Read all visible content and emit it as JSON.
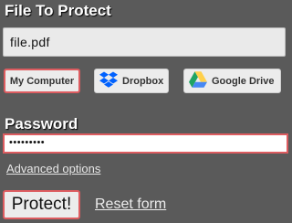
{
  "file_section": {
    "title": "File To Protect",
    "filename": "file.pdf"
  },
  "sources": {
    "computer_label": "My Computer",
    "dropbox_label": "Dropbox",
    "gdrive_label": "Google Drive",
    "selected": "My Computer"
  },
  "password_section": {
    "title": "Password",
    "masked_value": "•••••••••"
  },
  "links": {
    "advanced_options": "Advanced options",
    "reset_form": "Reset form"
  },
  "actions": {
    "protect_label": "Protect!"
  },
  "colors": {
    "background": "#5a5a5a",
    "highlight_border": "#dd5c60",
    "dropbox_blue": "#0061fe",
    "gdrive_green": "#1fa463",
    "gdrive_yellow": "#ffd04b",
    "gdrive_blue": "#4688f4"
  },
  "icons": {
    "dropbox": "dropbox-icon",
    "gdrive": "google-drive-icon"
  }
}
